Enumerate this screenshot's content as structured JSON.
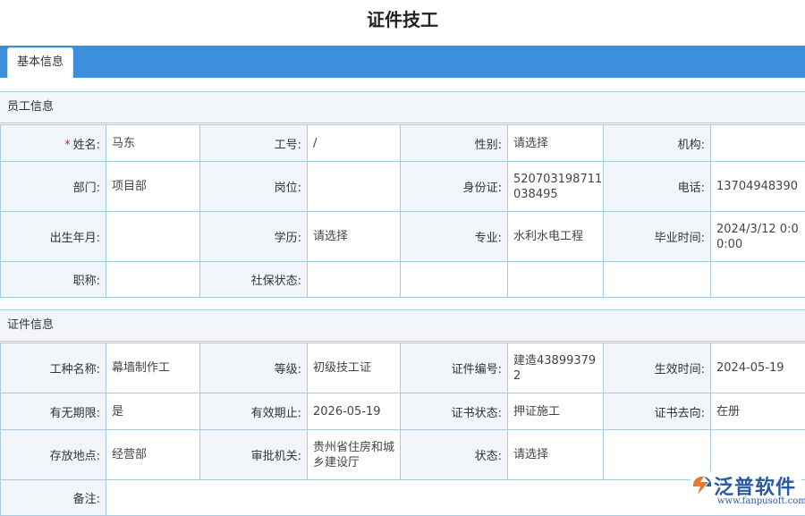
{
  "page": {
    "title": "证件技工"
  },
  "tabs": [
    {
      "label": "基本信息"
    }
  ],
  "employee": {
    "heading": "员工信息",
    "name_label": "姓名:",
    "name": "马东",
    "work_no_label": "工号:",
    "work_no": "/",
    "gender_label": "性别:",
    "gender": "请选择",
    "org_label": "机构:",
    "org": "",
    "dept_label": "部门:",
    "dept": "项目部",
    "post_label": "岗位:",
    "post": "",
    "id_label": "身份证:",
    "id_no": "520703198711038495",
    "phone_label": "电话:",
    "phone": "13704948390",
    "birth_label": "出生年月:",
    "birth": "",
    "edu_label": "学历:",
    "edu": "请选择",
    "major_label": "专业:",
    "major": "水利水电工程",
    "grad_label": "毕业时间:",
    "grad_time": "2024/3/12 0:00:00",
    "title_label": "职称:",
    "prof_title": "",
    "insurance_label": "社保状态:",
    "insurance": ""
  },
  "certificate": {
    "heading": "证件信息",
    "trade_label": "工种名称:",
    "trade": "幕墙制作工",
    "level_label": "等级:",
    "level": "初级技工证",
    "cert_no_label": "证件编号:",
    "cert_no": "建造438993792",
    "effective_label": "生效时间:",
    "effective": "2024-05-19",
    "has_expiry_label": "有无期限:",
    "has_expiry": "是",
    "expiry_label": "有效期止:",
    "expiry": "2026-05-19",
    "cert_status_label": "证书状态:",
    "cert_status": "押证施工",
    "whereabouts_label": "证书去向:",
    "whereabouts": "在册",
    "storage_label": "存放地点:",
    "storage": "经营部",
    "authority_label": "审批机关:",
    "authority": "贵州省住房和城乡建设厅",
    "status_label": "状态:",
    "status": "请选择",
    "remark_label": "备注:",
    "remark": ""
  },
  "watermark": {
    "name": "泛普软件",
    "url": "www.fanpusoft.com"
  },
  "colors": {
    "tab_bar": "#3c8fdb",
    "label_bg": "#f2f6fb",
    "border": "#a9cbe0",
    "required": "#e02020",
    "logo": "#2b5aa0"
  }
}
